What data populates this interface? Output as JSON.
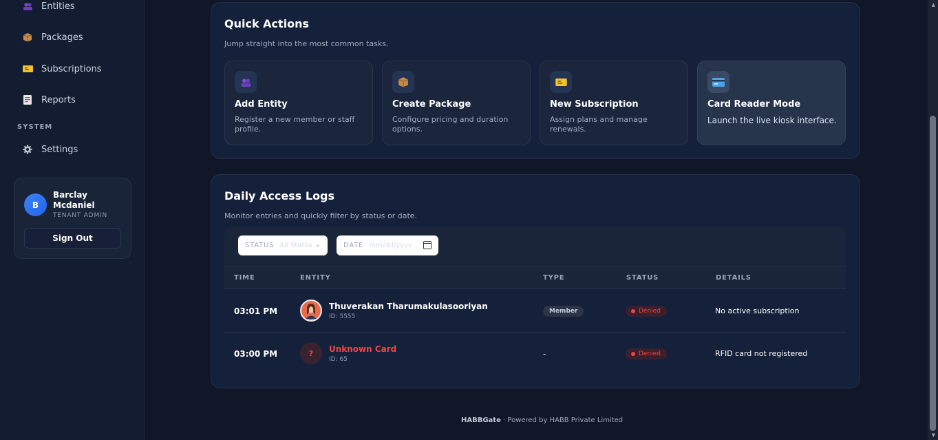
{
  "sidebar": {
    "items": [
      {
        "label": "Entities",
        "icon": "users-icon"
      },
      {
        "label": "Packages",
        "icon": "package-icon"
      },
      {
        "label": "Subscriptions",
        "icon": "ticket-icon"
      },
      {
        "label": "Reports",
        "icon": "report-icon"
      }
    ],
    "section_system": "SYSTEM",
    "settings_label": "Settings"
  },
  "user": {
    "initial": "B",
    "name": "Barclay Mcdaniel",
    "role": "TENANT ADMIN",
    "signout_label": "Sign Out"
  },
  "quick_actions": {
    "title": "Quick Actions",
    "subtitle": "Jump straight into the most common tasks.",
    "cards": [
      {
        "title": "Add Entity",
        "desc": "Register a new member or staff profile.",
        "icon": "users-icon"
      },
      {
        "title": "Create Package",
        "desc": "Configure pricing and duration options.",
        "icon": "package-icon"
      },
      {
        "title": "New Subscription",
        "desc": "Assign plans and manage renewals.",
        "icon": "ticket-icon"
      },
      {
        "title": "Card Reader Mode",
        "desc": "Launch the live kiosk interface.",
        "icon": "card-icon"
      }
    ]
  },
  "logs": {
    "title": "Daily Access Logs",
    "subtitle": "Monitor entries and quickly filter by status or date.",
    "filters": {
      "status_label": "STATUS",
      "status_value": "All Status",
      "date_label": "DATE",
      "date_value": "mm/dd/yyyy"
    },
    "columns": [
      "TIME",
      "ENTITY",
      "TYPE",
      "STATUS",
      "DETAILS"
    ],
    "rows": [
      {
        "time": "03:01 PM",
        "name": "Thuverakan Tharumakulasooriyan",
        "id": "ID: 5555",
        "type": "Member",
        "status": "Denied",
        "details": "No active subscription"
      },
      {
        "time": "03:00 PM",
        "name": "Unknown Card",
        "id": "ID: 65",
        "type": "-",
        "status": "Denied",
        "details": "RFID card not registered",
        "avatar": "?"
      }
    ]
  },
  "footer": {
    "brand": "HABBGate",
    "text": " · Powered by HABB Private Limited"
  },
  "colors": {
    "background": "#0f1729",
    "panel": "#15213a",
    "accent": "#3b82f6",
    "danger": "#ef4444"
  }
}
